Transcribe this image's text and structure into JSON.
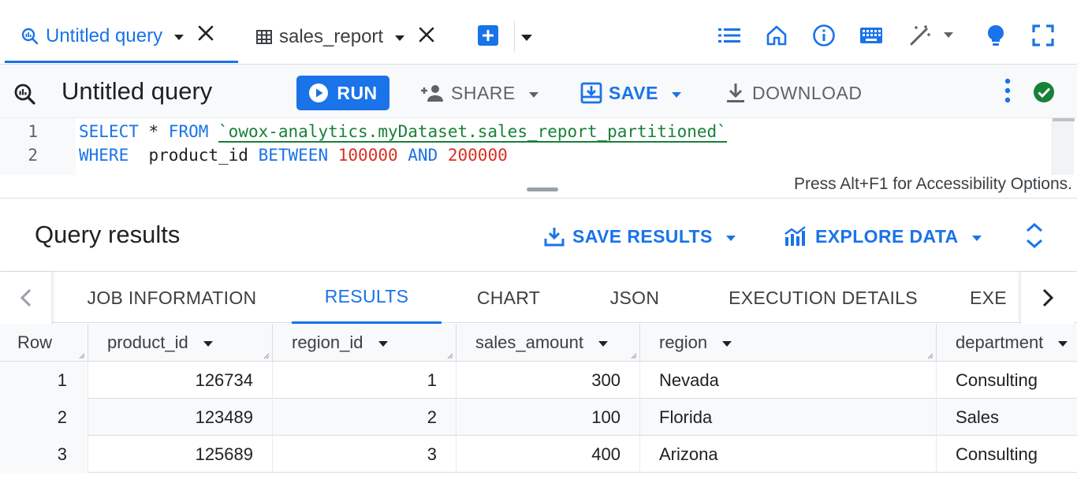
{
  "tabs": [
    {
      "label": "Untitled query",
      "active": true
    },
    {
      "label": "sales_report",
      "active": false
    }
  ],
  "toolbar": {
    "title": "Untitled query",
    "run_label": "RUN",
    "share_label": "SHARE",
    "save_label": "SAVE",
    "download_label": "DOWNLOAD"
  },
  "editor": {
    "lines": [
      {
        "n": "1",
        "t1": "SELECT",
        "t2": " * ",
        "t3": "FROM",
        "t4": " ",
        "t5": "`owox-analytics.myDataset.sales_report_partitioned`"
      },
      {
        "n": "2",
        "t1": "WHERE",
        "t2": "  product_id ",
        "t3": "BETWEEN",
        "t4": " ",
        "t5": "100000",
        "t6": " ",
        "t7": "AND",
        "t8": " ",
        "t9": "200000"
      }
    ],
    "accessibility_hint": "Press Alt+F1 for Accessibility Options."
  },
  "results": {
    "title": "Query results",
    "save_results_label": "SAVE RESULTS",
    "explore_label": "EXPLORE DATA",
    "tabs": [
      "JOB INFORMATION",
      "RESULTS",
      "CHART",
      "JSON",
      "EXECUTION DETAILS",
      "EXE"
    ],
    "active_tab": "RESULTS",
    "columns": [
      "Row",
      "product_id",
      "region_id",
      "sales_amount",
      "region",
      "department"
    ],
    "rows": [
      [
        "1",
        "126734",
        "1",
        "300",
        "Nevada",
        "Consulting"
      ],
      [
        "2",
        "123489",
        "2",
        "100",
        "Florida",
        "Sales"
      ],
      [
        "3",
        "125689",
        "3",
        "400",
        "Arizona",
        "Consulting"
      ]
    ]
  },
  "colors": {
    "accent": "#1a73e8",
    "keyword": "#1a73e8",
    "string": "#188038",
    "number": "#d93025",
    "status_ok": "#188038"
  },
  "icons": [
    "query-icon",
    "caret-down-icon",
    "close-icon",
    "table-icon",
    "add-tab-icon",
    "list-icon",
    "home-icon",
    "info-icon",
    "keyboard-icon",
    "magic-wand-icon",
    "lightbulb-icon",
    "fullscreen-icon",
    "play-icon",
    "add-person-icon",
    "save-icon",
    "download-icon",
    "more-vert-icon",
    "check-circle-icon",
    "save-results-icon",
    "explore-chart-icon",
    "unfold-icon",
    "chevron-left-icon",
    "chevron-right-icon",
    "column-sort-icon",
    "resize-grip-icon"
  ]
}
